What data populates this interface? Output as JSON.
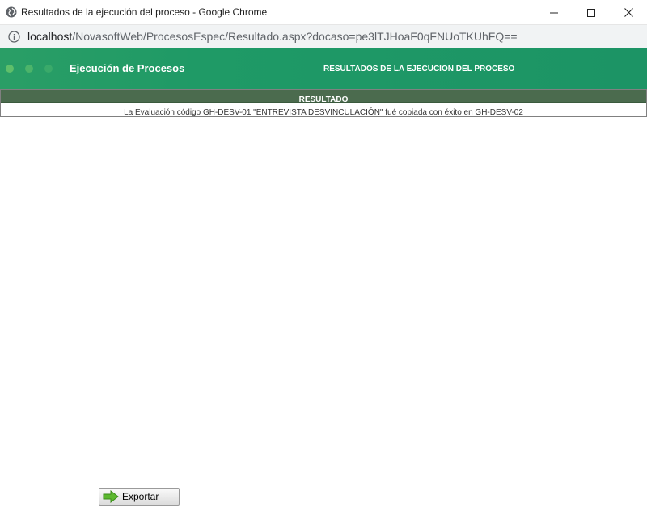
{
  "window": {
    "title": "Resultados de la ejecución del proceso - Google Chrome",
    "icon": "globe-icon"
  },
  "address_bar": {
    "host": "localhost",
    "path": "/NovasoftWeb/ProcesosEspec/Resultado.aspx?docaso=pe3lTJHoaF0qFNUoTKUhFQ=="
  },
  "header": {
    "app_title": "Ejecución de Procesos",
    "section_title": "RESULTADOS DE LA EJECUCION DEL PROCESO",
    "color": "#1f9a66"
  },
  "result": {
    "column_header": "RESULTADO",
    "rows": [
      "La Evaluación código GH-DESV-01 \"ENTREVISTA DESVINCULACIÓN\" fué copiada con éxito en GH-DESV-02"
    ]
  },
  "actions": {
    "export_label": "Exportar",
    "export_icon": "green-arrow-right-icon"
  }
}
